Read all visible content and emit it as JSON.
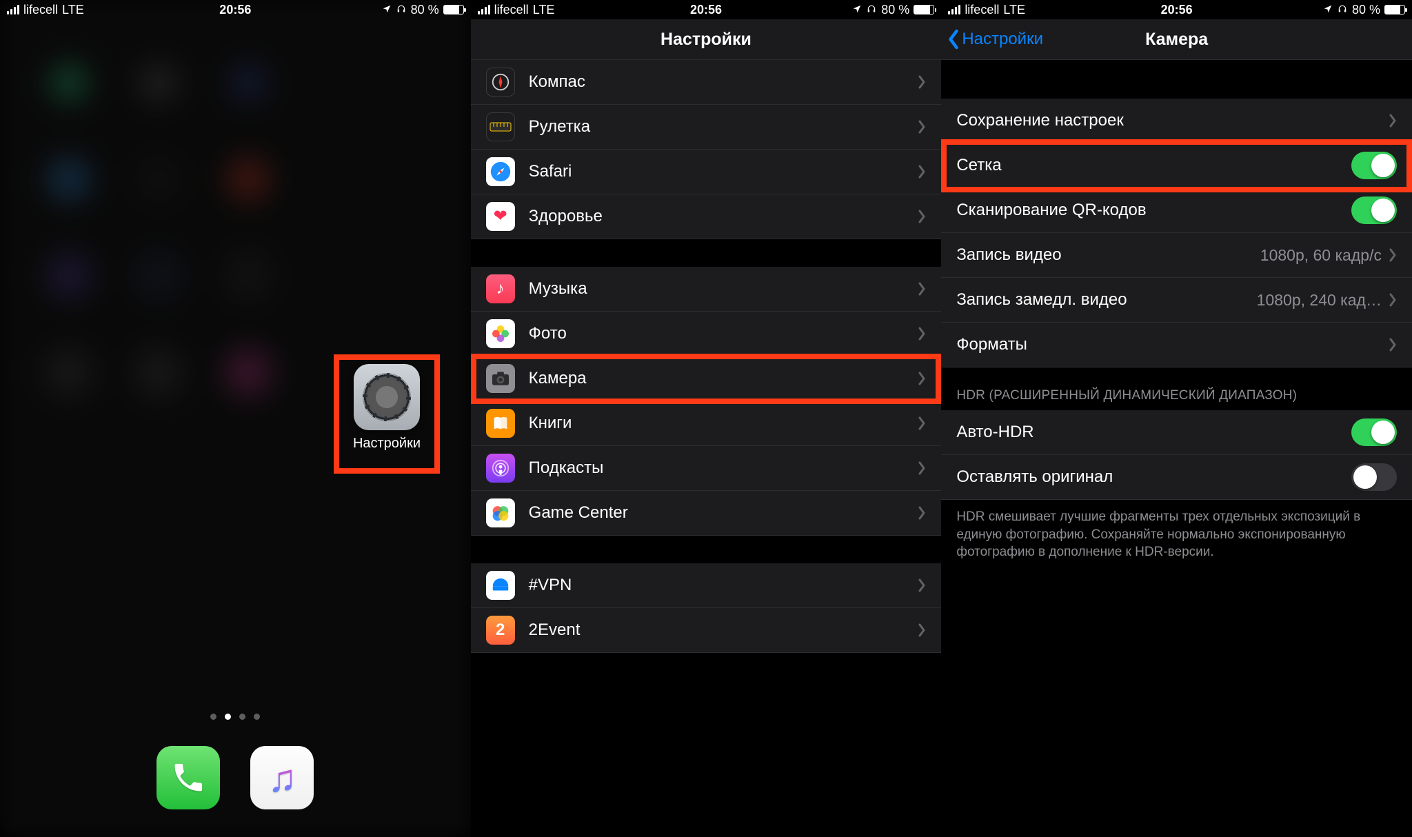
{
  "status": {
    "carrier": "lifecell",
    "network": "LTE",
    "time": "20:56",
    "battery_pct": "80 %"
  },
  "panel1": {
    "settings_label": "Настройки",
    "dots_total": 4,
    "dots_active_index": 1
  },
  "panel2": {
    "title": "Настройки",
    "groups": [
      {
        "items": [
          {
            "key": "compass",
            "label": "Компас"
          },
          {
            "key": "measure",
            "label": "Рулетка"
          },
          {
            "key": "safari",
            "label": "Safari"
          },
          {
            "key": "health",
            "label": "Здоровье"
          }
        ]
      },
      {
        "items": [
          {
            "key": "music",
            "label": "Музыка"
          },
          {
            "key": "photos",
            "label": "Фото"
          },
          {
            "key": "camera",
            "label": "Камера",
            "highlight": true
          },
          {
            "key": "books",
            "label": "Книги"
          },
          {
            "key": "podcasts",
            "label": "Подкасты"
          },
          {
            "key": "gamecenter",
            "label": "Game Center"
          }
        ]
      },
      {
        "items": [
          {
            "key": "vpn",
            "label": "#VPN"
          },
          {
            "key": "2event",
            "label": "2Event"
          }
        ]
      }
    ]
  },
  "panel3": {
    "back_label": "Настройки",
    "title": "Камера",
    "rows": [
      {
        "key": "preserve",
        "type": "nav",
        "label": "Сохранение настроек"
      },
      {
        "key": "grid",
        "type": "toggle",
        "label": "Сетка",
        "on": true,
        "highlight": true
      },
      {
        "key": "qr",
        "type": "toggle",
        "label": "Сканирование QR-кодов",
        "on": true
      },
      {
        "key": "video",
        "type": "value",
        "label": "Запись видео",
        "value": "1080p, 60 кадр/с"
      },
      {
        "key": "slomo",
        "type": "value",
        "label": "Запись замедл. видео",
        "value": "1080p, 240 кад…"
      },
      {
        "key": "formats",
        "type": "nav",
        "label": "Форматы"
      }
    ],
    "hdr_header": "HDR (РАСШИРЕННЫЙ ДИНАМИЧЕСКИЙ ДИАПАЗОН)",
    "hdr_rows": [
      {
        "key": "autohdr",
        "type": "toggle",
        "label": "Авто-HDR",
        "on": true
      },
      {
        "key": "keeporig",
        "type": "toggle",
        "label": "Оставлять оригинал",
        "on": false
      }
    ],
    "hdr_footer": "HDR смешивает лучшие фрагменты трех отдельных экспозиций в единую фотографию. Сохраняйте нормально экспонированную фотографию в дополнение к HDR-версии."
  }
}
